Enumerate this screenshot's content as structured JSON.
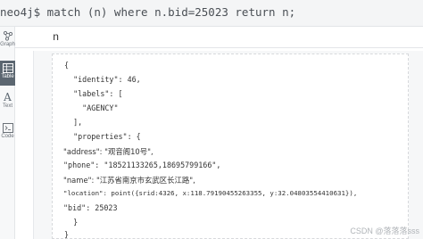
{
  "query_bar": {
    "text": "neo4j$ match (n) where n.bid=25023 return n;"
  },
  "sidebar": {
    "tools": [
      {
        "label": "Graph",
        "icon": "graph-icon",
        "active": false
      },
      {
        "label": "Table",
        "icon": "table-icon",
        "active": true
      },
      {
        "label": "Text",
        "icon": "text-icon",
        "active": false
      },
      {
        "label": "Code",
        "icon": "code-icon",
        "active": false
      }
    ]
  },
  "result": {
    "column": "n",
    "json_lines": [
      "{",
      "  \"identity\": 46,",
      "  \"labels\": [",
      "    \"AGENCY\"",
      "  ],",
      "  \"properties\": {",
      "\"address\": \"观音阁10号\",",
      "\"phone\": \"18521133265,18695799166\",",
      "\"name\": \"江苏省南京市玄武区长江路\",",
      "\"location\": point({srid:4326, x:118.79190455263355, y:32.04803554410631}),",
      "\"bid\": 25023",
      "  }",
      "}"
    ]
  },
  "watermark": "CSDN @落落落sss"
}
